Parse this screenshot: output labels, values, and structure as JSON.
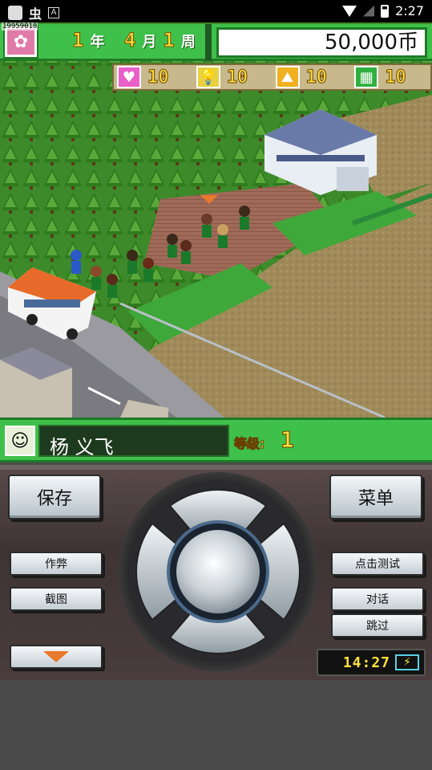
{
  "status_bar": {
    "time": "2:27",
    "left_glyph": "虫",
    "left_badge": "A"
  },
  "debug_id": "19959018",
  "hud": {
    "year_num": "1",
    "year_label": "年",
    "month_num": "4",
    "month_label": "月",
    "week_num": "1",
    "week_label": "周",
    "money": "50,000币",
    "flower_icon": "✿",
    "stats": [
      {
        "icon": "heart-icon",
        "glyph": "♥",
        "color": "#e860c8",
        "value": "10"
      },
      {
        "icon": "bulb-icon",
        "glyph": "💡",
        "color": "#e8d040",
        "value": "10"
      },
      {
        "icon": "hill-icon",
        "glyph": "⛰",
        "color": "#f0b020",
        "value": "10"
      },
      {
        "icon": "field-icon",
        "glyph": "▦",
        "color": "#30b040",
        "value": "10"
      }
    ]
  },
  "character": {
    "avatar_icon": "☺",
    "name": "杨 义飞",
    "level_label": "等级:",
    "level": "1"
  },
  "controls": {
    "save": "保存",
    "menu": "菜单",
    "cheat": "作弊",
    "screenshot": "截图",
    "click_test": "点击测试",
    "dialog": "对话",
    "skip": "跳过"
  },
  "clock": {
    "time": "14:27",
    "battery_glyph": "⚡"
  }
}
